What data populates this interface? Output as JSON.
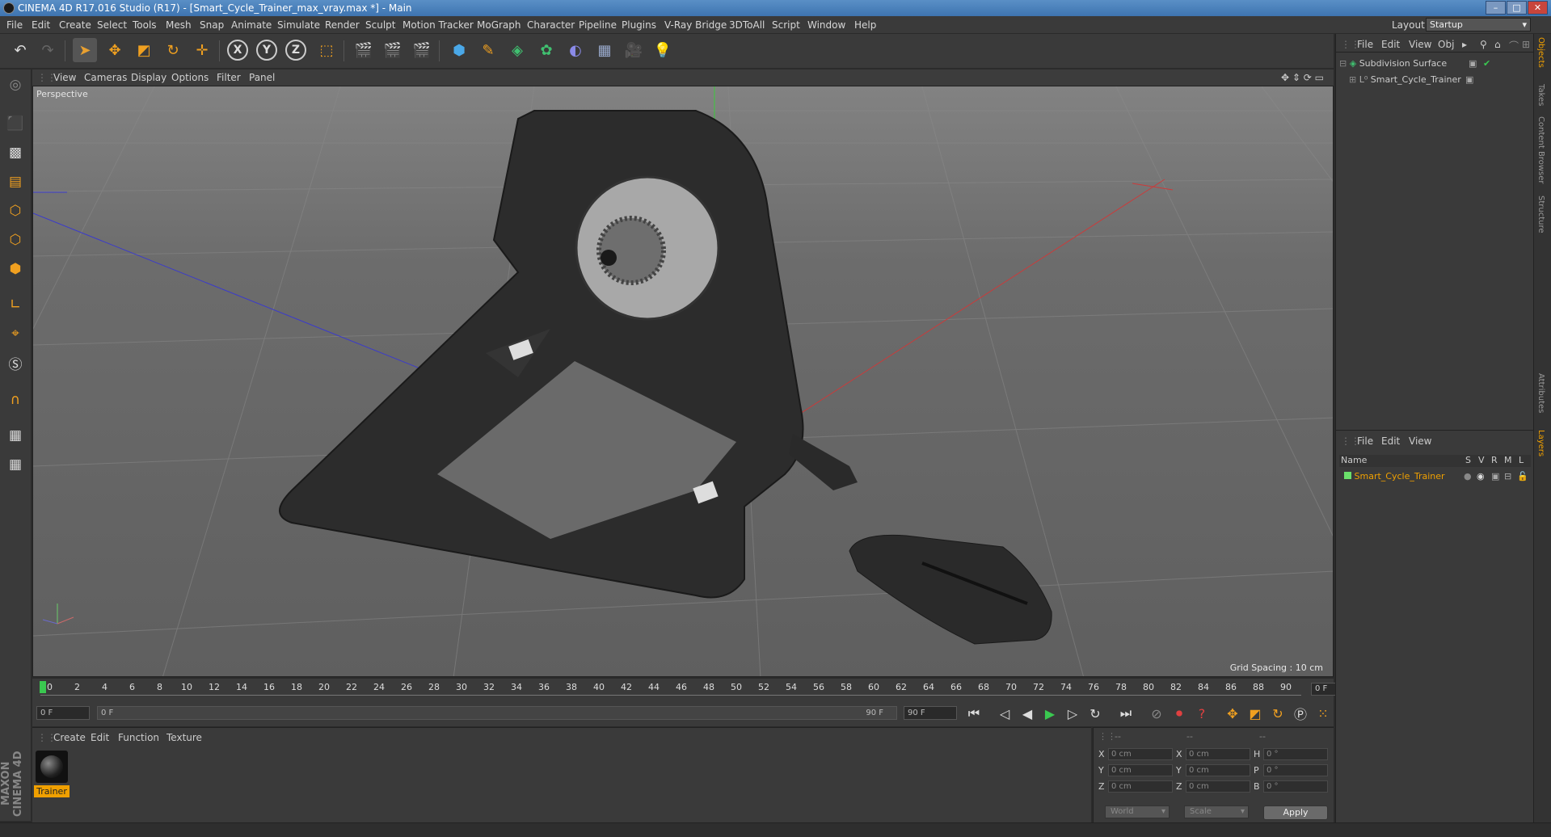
{
  "window": {
    "title": "CINEMA 4D R17.016 Studio (R17) - [Smart_Cycle_Trainer_max_vray.max *] - Main",
    "minimize": "–",
    "maximize": "□",
    "close": "✕"
  },
  "menu": {
    "items": [
      "File",
      "Edit",
      "Create",
      "Select",
      "Tools",
      "Mesh",
      "Snap",
      "Animate",
      "Simulate",
      "Render",
      "Sculpt",
      "Motion Tracker",
      "MoGraph",
      "Character",
      "Pipeline",
      "Plugins",
      "V-Ray Bridge",
      "3DToAll",
      "Script",
      "Window",
      "Help"
    ],
    "layout_label": "Layout:",
    "layout_value": "Startup"
  },
  "toolbar": {
    "x_label": "X",
    "y_label": "Y",
    "z_label": "Z"
  },
  "viewport": {
    "menu": [
      "View",
      "Cameras",
      "Display",
      "Options",
      "Filter",
      "Panel"
    ],
    "camera_label": "Perspective",
    "grid_spacing": "Grid Spacing : 10 cm"
  },
  "timeline": {
    "ticks": [
      "0",
      "2",
      "4",
      "6",
      "8",
      "10",
      "12",
      "14",
      "16",
      "18",
      "20",
      "22",
      "24",
      "26",
      "28",
      "30",
      "32",
      "34",
      "36",
      "38",
      "40",
      "42",
      "44",
      "46",
      "48",
      "50",
      "52",
      "54",
      "56",
      "58",
      "60",
      "62",
      "64",
      "66",
      "68",
      "70",
      "72",
      "74",
      "76",
      "78",
      "80",
      "82",
      "84",
      "86",
      "88",
      "90"
    ],
    "current_frame": "0 F",
    "start_field": "0 F",
    "range_start": "0 F",
    "range_end": "90 F",
    "end_field": "90 F"
  },
  "materials": {
    "menu": [
      "Create",
      "Edit",
      "Function",
      "Texture"
    ],
    "items": [
      {
        "name": "Trainer"
      }
    ]
  },
  "coords": {
    "headers": [
      "--",
      "--",
      "--"
    ],
    "rows": [
      {
        "a_label": "X",
        "a_val": "0 cm",
        "b_label": "X",
        "b_val": "0 cm",
        "c_label": "H",
        "c_val": "0 °"
      },
      {
        "a_label": "Y",
        "a_val": "0 cm",
        "b_label": "Y",
        "b_val": "0 cm",
        "c_label": "P",
        "c_val": "0 °"
      },
      {
        "a_label": "Z",
        "a_val": "0 cm",
        "b_label": "Z",
        "b_val": "0 cm",
        "c_label": "B",
        "c_val": "0 °"
      }
    ],
    "world": "World",
    "scale": "Scale",
    "apply": "Apply"
  },
  "objects": {
    "menu": [
      "File",
      "Edit",
      "View",
      "Obj"
    ],
    "items": [
      {
        "name": "Subdivision Surface"
      },
      {
        "name": "Smart_Cycle_Trainer"
      }
    ]
  },
  "layers": {
    "menu": [
      "File",
      "Edit",
      "View"
    ],
    "header_name": "Name",
    "header_cols": [
      "S",
      "V",
      "R",
      "M",
      "L"
    ],
    "items": [
      {
        "name": "Smart_Cycle_Trainer"
      }
    ]
  },
  "right_tabs": [
    "Objects",
    "Takes",
    "Content Browser",
    "Structure",
    "Attributes",
    "Layers"
  ],
  "logo": "MAXON CINEMA 4D"
}
